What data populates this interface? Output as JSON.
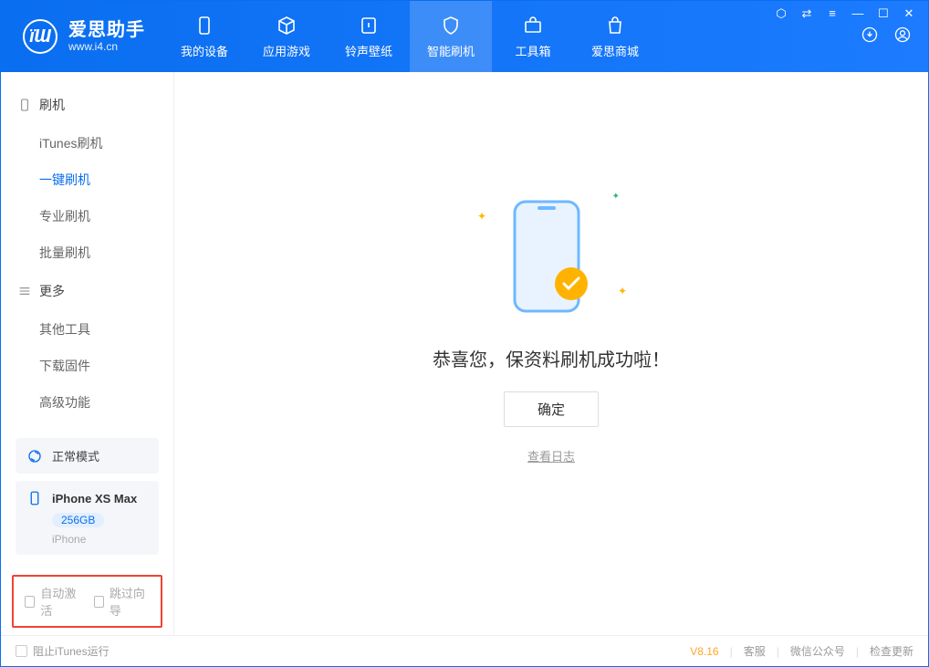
{
  "app": {
    "title": "爱思助手",
    "subtitle": "www.i4.cn"
  },
  "nav": {
    "items": [
      {
        "label": "我的设备"
      },
      {
        "label": "应用游戏"
      },
      {
        "label": "铃声壁纸"
      },
      {
        "label": "智能刷机"
      },
      {
        "label": "工具箱"
      },
      {
        "label": "爱思商城"
      }
    ]
  },
  "sidebar": {
    "section_flash": "刷机",
    "section_more": "更多",
    "flash_items": [
      "iTunes刷机",
      "一键刷机",
      "专业刷机",
      "批量刷机"
    ],
    "more_items": [
      "其他工具",
      "下载固件",
      "高级功能"
    ],
    "mode": "正常模式",
    "device_name": "iPhone XS Max",
    "device_storage": "256GB",
    "device_type": "iPhone",
    "opt_auto_activate": "自动激活",
    "opt_skip_guide": "跳过向导"
  },
  "main": {
    "success_text": "恭喜您，保资料刷机成功啦！",
    "confirm_label": "确定",
    "view_log": "查看日志"
  },
  "footer": {
    "prevent_itunes": "阻止iTunes运行",
    "version": "V8.16",
    "support": "客服",
    "wechat": "微信公众号",
    "update": "检查更新"
  }
}
